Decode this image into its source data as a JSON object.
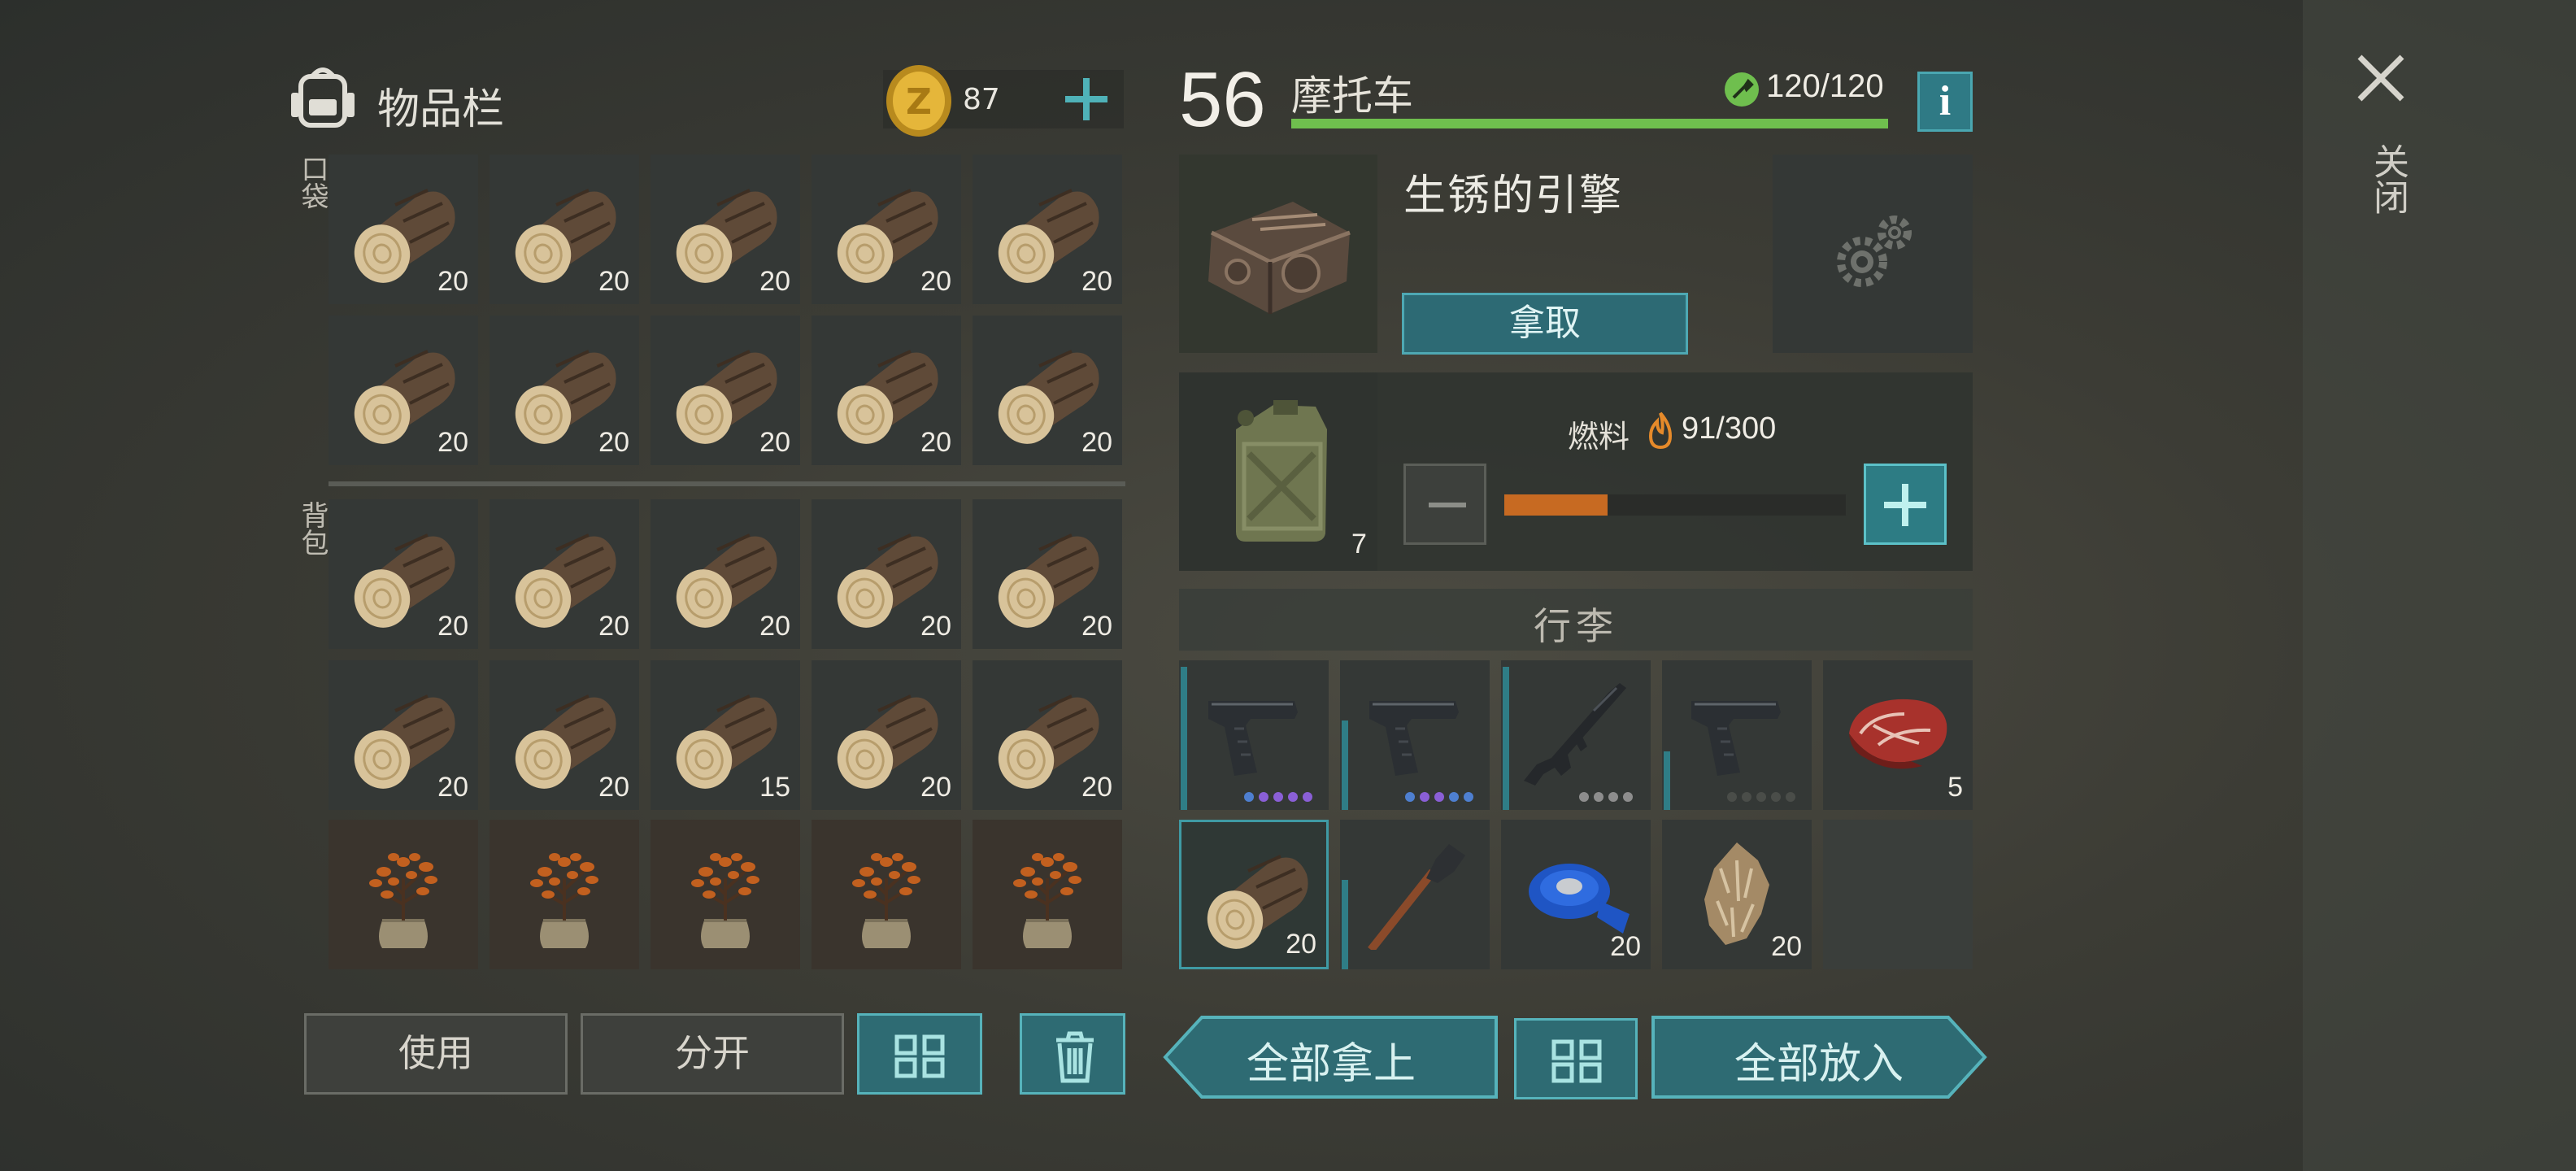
{
  "inventory": {
    "title": "物品栏",
    "coins": "87",
    "pocket_label": "口袋",
    "backpack_label": "背包",
    "pocket_counts": [
      "20",
      "20",
      "20",
      "20",
      "20",
      "20",
      "20",
      "20",
      "20",
      "20"
    ],
    "backpack_counts": [
      "20",
      "20",
      "20",
      "20",
      "20",
      "20",
      "20",
      "15",
      "20",
      "20"
    ]
  },
  "vehicle": {
    "level": "56",
    "name": "摩托车",
    "durability": "120/120",
    "durability_fraction": 1.0,
    "engine_title": "生锈的引擎",
    "take_label": "拿取",
    "fuel_label": "燃料",
    "fuel_value": "91/300",
    "fuel_fraction": 0.303,
    "fuel_can_count": "7",
    "luggage_title": "行李",
    "luggage_counts": {
      "meat": "5",
      "log": "20",
      "tape": "20",
      "fur": "20"
    }
  },
  "buttons": {
    "use": "使用",
    "split": "分开",
    "take_all": "全部拿上",
    "put_all": "全部放入"
  },
  "close_label": "关闭",
  "colors": {
    "teal_button": "#2e6b73",
    "durability_bar": "#6fbf4e",
    "fuel_bar": "#c76a22",
    "rarity_purple": "#8a5fd6",
    "rarity_blue": "#4e7fd0",
    "rarity_gray": "#8d8d8d"
  }
}
